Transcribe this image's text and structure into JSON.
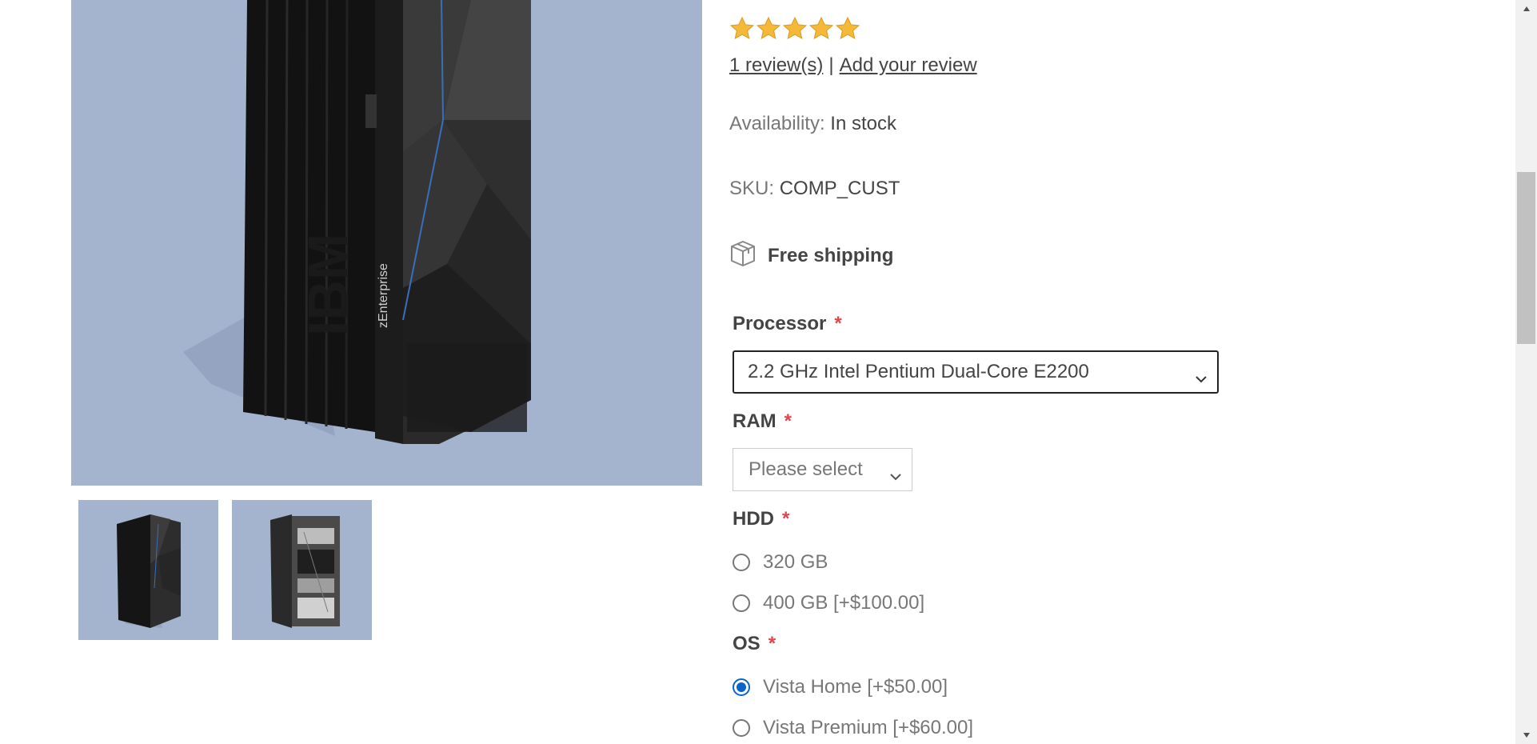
{
  "product": {
    "main_picture_alt": "Picture of Build your own computer",
    "thumbnails": [
      {
        "alt": "Picture of Build your own computer"
      },
      {
        "alt": "Picture of Build your own computer"
      }
    ],
    "rating_stars": 5,
    "reviews_link": "1 review(s)",
    "reviews_separator": "|",
    "add_review_link": "Add your review",
    "availability_label": "Availability:",
    "availability_value": "In stock",
    "sku_label": "SKU:",
    "sku_value": "COMP_CUST",
    "free_shipping": "Free shipping"
  },
  "attributes": {
    "required_marker": "*",
    "processor": {
      "label": "Processor",
      "selected": "2.2 GHz Intel Pentium Dual-Core E2200"
    },
    "ram": {
      "label": "RAM",
      "selected": "Please select"
    },
    "hdd": {
      "label": "HDD",
      "options": [
        {
          "label": "320 GB",
          "checked": false
        },
        {
          "label": "400 GB [+$100.00]",
          "checked": false
        }
      ]
    },
    "os": {
      "label": "OS",
      "options": [
        {
          "label": "Vista Home [+$50.00]",
          "checked": true
        },
        {
          "label": "Vista Premium [+$60.00]",
          "checked": false
        }
      ]
    }
  },
  "colors": {
    "image_background": "#a4b4cf",
    "star": "#f5b93a",
    "required": "#e4434b",
    "radio_checked": "#0b63ce"
  }
}
